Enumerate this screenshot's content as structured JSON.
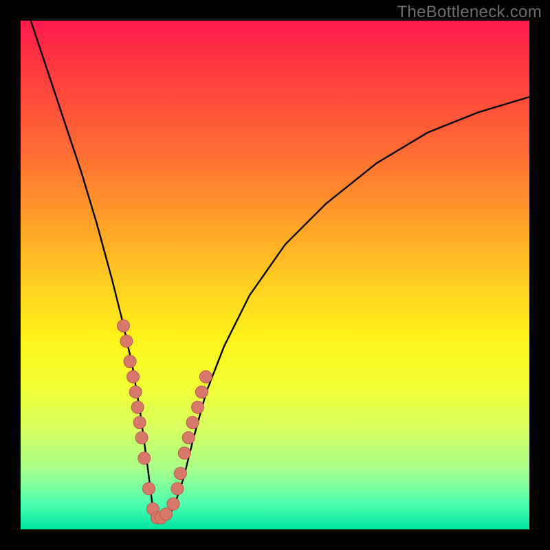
{
  "watermark": "TheBottleneck.com",
  "colors": {
    "background": "#000000",
    "gradient_top": "#ff1a4d",
    "gradient_bottom": "#00e6a0",
    "curve": "#000000",
    "marker_fill": "#d8786b",
    "marker_stroke": "#b85a50"
  },
  "chart_data": {
    "type": "line",
    "title": "",
    "xlabel": "",
    "ylabel": "",
    "xlim": [
      0,
      100
    ],
    "ylim": [
      0,
      100
    ],
    "grid": false,
    "legend": false,
    "series": [
      {
        "name": "bottleneck-curve",
        "x": [
          2,
          5,
          8,
          12,
          15,
          18,
          20,
          22,
          23.5,
          25,
          26,
          27,
          28,
          30,
          32,
          34,
          36.5,
          40,
          45,
          52,
          60,
          70,
          80,
          90,
          100
        ],
        "y": [
          100,
          91,
          82,
          70,
          60,
          49,
          41,
          32,
          23,
          12,
          4,
          2,
          2.2,
          4,
          10,
          18,
          27,
          36,
          46,
          56,
          64,
          72,
          78,
          82,
          85
        ]
      }
    ],
    "markers": {
      "name": "highlighted-points",
      "x": [
        20.2,
        20.8,
        21.5,
        22.1,
        22.6,
        23.0,
        23.4,
        23.8,
        24.3,
        25.2,
        26.0,
        26.8,
        27.6,
        28.6,
        30.0,
        30.8,
        31.4,
        32.2,
        33.0,
        33.8,
        34.8,
        35.6,
        36.4
      ],
      "y": [
        40,
        37,
        33,
        30,
        27,
        24,
        21,
        18,
        14,
        8,
        4,
        2.3,
        2.3,
        3,
        5,
        8,
        11,
        15,
        18,
        21,
        24,
        27,
        30
      ]
    }
  }
}
